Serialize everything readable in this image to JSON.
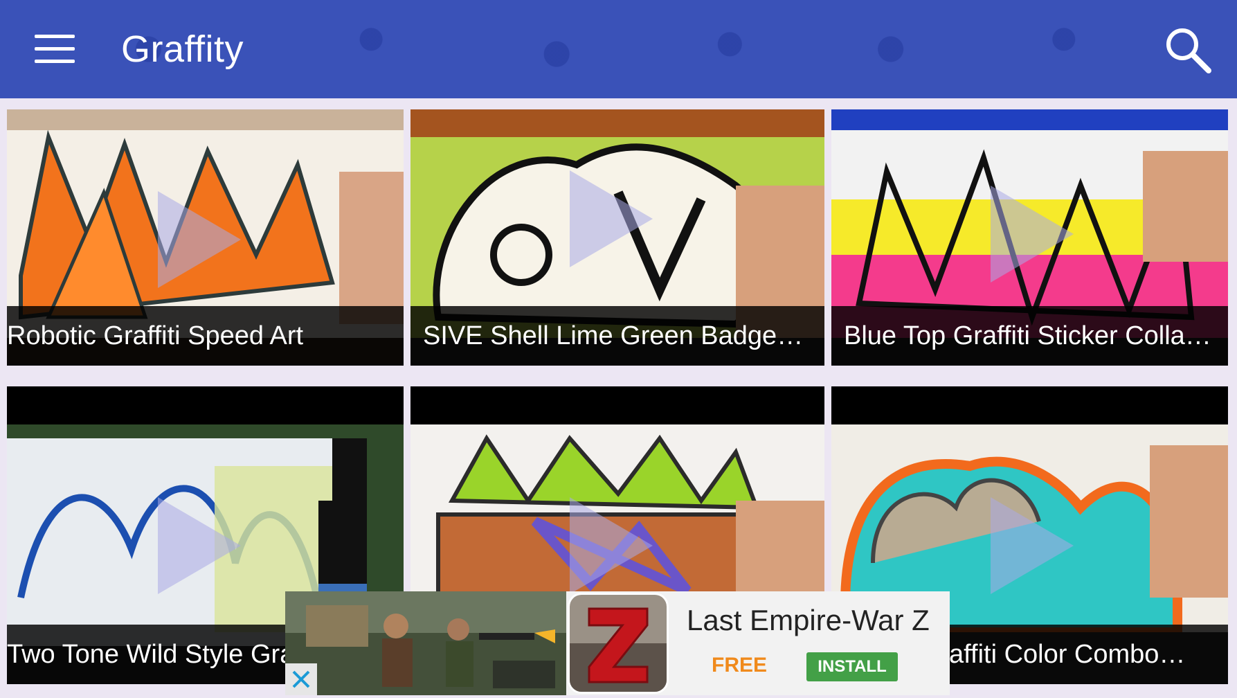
{
  "app_bar": {
    "title": "Graffity",
    "menu_icon": "hamburger-menu-icon",
    "search_icon": "search-icon",
    "background_color": "#3a52b8"
  },
  "videos": [
    {
      "title": "Robotic Graffiti Speed Art"
    },
    {
      "title": "SIVE Shell Lime Green Badges…"
    },
    {
      "title": "Blue Top Graffiti Sticker Collab…"
    },
    {
      "title": "Two Tone Wild Style Gra"
    },
    {
      "title": ""
    },
    {
      "title": "affiti Color Combo…"
    }
  ],
  "ad": {
    "app_name": "Last Empire-War Z",
    "price": "FREE",
    "install_label": "INSTALL",
    "close_icon": "close-icon",
    "price_color": "#f08a1c",
    "install_color": "#43a047"
  }
}
